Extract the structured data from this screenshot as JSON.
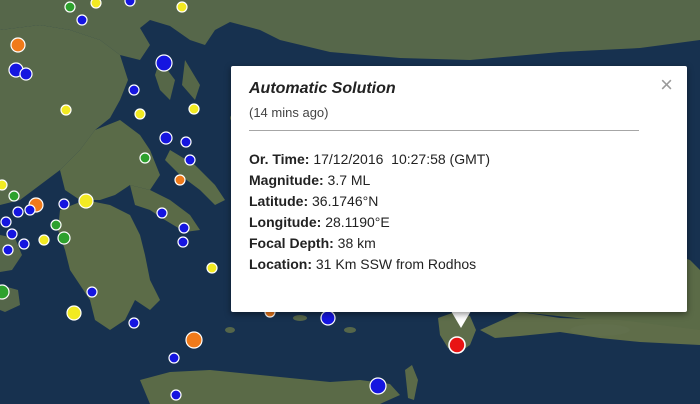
{
  "popup": {
    "title": "Automatic Solution",
    "subtitle": "(14 mins ago)",
    "close_glyph": "×",
    "rows": [
      {
        "label": "Or. Time:",
        "value": " 17/12/2016  10:27:58 (GMT)"
      },
      {
        "label": "Magnitude:",
        "value": " 3.7 ML"
      },
      {
        "label": "Latitude:",
        "value": " 36.1746°N"
      },
      {
        "label": "Longitude:",
        "value": " 28.1190°E"
      },
      {
        "label": "Focal Depth:",
        "value": " 38 km"
      },
      {
        "label": "Location:",
        "value": " 31 Km SSW from Rodhos"
      }
    ]
  },
  "colors": {
    "sea": "#16304f",
    "land": "#5a6a48",
    "marker_blue": "#1515e0",
    "marker_yellow": "#f2ea22",
    "marker_green": "#2da12d",
    "marker_orange": "#f07a1a",
    "marker_selected": "#e81313"
  },
  "icons": {
    "close": "close-icon",
    "marker": "earthquake-marker-icon"
  }
}
